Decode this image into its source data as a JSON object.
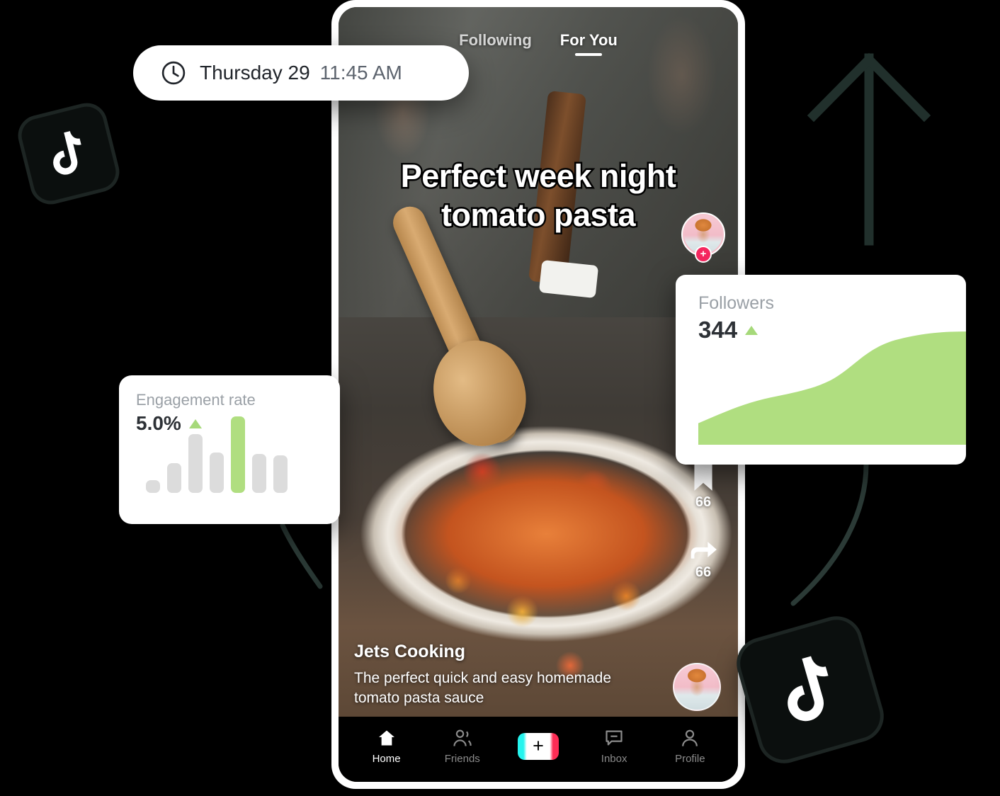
{
  "clock": {
    "icon": "clock-icon",
    "date": "Thursday 29",
    "time": "11:45 AM"
  },
  "phone": {
    "tabs": [
      {
        "label": "Following",
        "active": false
      },
      {
        "label": "For You",
        "active": true
      }
    ],
    "video": {
      "headline": "Perfect week night tomato pasta",
      "username": "Jets Cooking",
      "caption": "The perfect quick and easy homemade tomato pasta sauce"
    },
    "rail": {
      "follow_badge": "+",
      "actions": [
        {
          "icon": "bookmark-icon",
          "count": "66"
        },
        {
          "icon": "share-arrow-icon",
          "count": "66"
        }
      ]
    },
    "nav": [
      {
        "label": "Home",
        "icon": "home-icon",
        "active": true
      },
      {
        "label": "Friends",
        "icon": "friends-icon",
        "active": false
      },
      {
        "label": "",
        "icon": "create-plus-icon",
        "active": false
      },
      {
        "label": "Inbox",
        "icon": "inbox-icon",
        "active": false
      },
      {
        "label": "Profile",
        "icon": "profile-icon",
        "active": false
      }
    ]
  },
  "cards": {
    "engagement": {
      "label": "Engagement rate",
      "value": "5.0%",
      "trend": "up"
    },
    "followers": {
      "label": "Followers",
      "value": "344",
      "trend": "up"
    }
  },
  "colors": {
    "accent_green": "#b0de80",
    "bar_grey": "#dcdcdc",
    "tiktok_cyan": "#25f4ee",
    "tiktok_pink": "#fe2c55",
    "card_bg": "#ffffff",
    "background": "#000000"
  },
  "decorations": {
    "up_arrow": "up-arrow-icon",
    "tiktok_badges": [
      "tiktok-logo-small",
      "tiktok-logo-large"
    ]
  },
  "chart_data": [
    {
      "type": "bar",
      "title": "Engagement rate",
      "categories": [
        "1",
        "2",
        "3",
        "4",
        "5",
        "6",
        "7"
      ],
      "values": [
        16,
        38,
        76,
        52,
        100,
        50,
        48
      ],
      "highlight_index": 4,
      "xlabel": "",
      "ylabel": "",
      "ylim": [
        0,
        100
      ],
      "grid": false,
      "legend": "none"
    },
    {
      "type": "area",
      "title": "Followers",
      "x": [
        0,
        1,
        2,
        3,
        4,
        5,
        6,
        7,
        8,
        9,
        10
      ],
      "values": [
        18,
        26,
        34,
        39,
        42,
        46,
        56,
        72,
        88,
        95,
        97
      ],
      "xlabel": "",
      "ylabel": "",
      "ylim": [
        0,
        100
      ],
      "grid": false,
      "legend": "none"
    }
  ]
}
